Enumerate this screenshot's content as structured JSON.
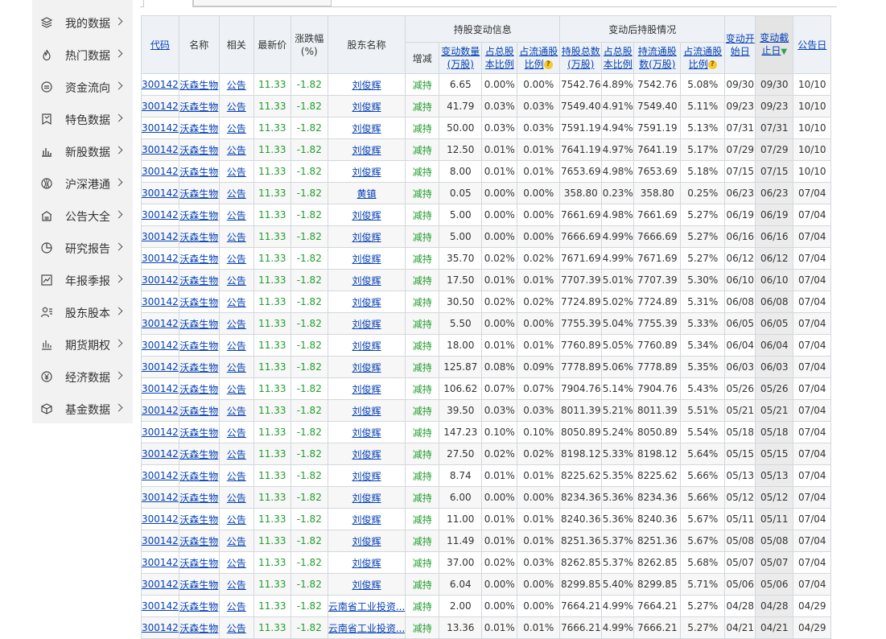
{
  "sidebar": {
    "items": [
      {
        "label": "我的数据",
        "icon": "layers-icon"
      },
      {
        "label": "热门数据",
        "icon": "fire-icon"
      },
      {
        "label": "资金流向",
        "icon": "money-flow-icon"
      },
      {
        "label": "特色数据",
        "icon": "bookmark-icon"
      },
      {
        "label": "新股数据",
        "icon": "bar-chart-icon"
      },
      {
        "label": "沪深港通",
        "icon": "globe-icon"
      },
      {
        "label": "公告大全",
        "icon": "announcement-icon"
      },
      {
        "label": "研究报告",
        "icon": "pie-chart-icon"
      },
      {
        "label": "年报季报",
        "icon": "line-chart-icon"
      },
      {
        "label": "股东股本",
        "icon": "shareholder-icon"
      },
      {
        "label": "期货期权",
        "icon": "futures-icon"
      },
      {
        "label": "经济数据",
        "icon": "yuan-icon"
      },
      {
        "label": "基金数据",
        "icon": "fund-icon"
      }
    ]
  },
  "table": {
    "headers": {
      "code": "代码",
      "name": "名称",
      "related": "相关",
      "price": "最新价",
      "change": "涨跌幅(%)",
      "holder": "股东名称",
      "group_change": "持股变动信息",
      "group_after": "变动后持股情况",
      "direction": "增减",
      "change_qty": "变动数量(万股)",
      "pct_total": "占总股本比例",
      "pct_float": "占流通股比例",
      "hold_total": "持股总数(万股)",
      "hold_total_pct": "占总股本比例",
      "float_hold": "持流通股数(万股)",
      "float_hold_pct": "占流通股比例",
      "start": "变动开始日",
      "end": "变动截止日",
      "notice": "公告日"
    },
    "rows": [
      [
        "300142",
        "沃森生物",
        "公告",
        "11.33",
        "-1.82",
        "刘俊辉",
        "减持",
        "6.65",
        "0.00%",
        "0.00%",
        "7542.76",
        "4.89%",
        "7542.76",
        "5.08%",
        "09/30",
        "09/30",
        "10/10"
      ],
      [
        "300142",
        "沃森生物",
        "公告",
        "11.33",
        "-1.82",
        "刘俊辉",
        "减持",
        "41.79",
        "0.03%",
        "0.03%",
        "7549.40",
        "4.91%",
        "7549.40",
        "5.11%",
        "09/23",
        "09/23",
        "10/10"
      ],
      [
        "300142",
        "沃森生物",
        "公告",
        "11.33",
        "-1.82",
        "刘俊辉",
        "减持",
        "50.00",
        "0.03%",
        "0.03%",
        "7591.19",
        "4.94%",
        "7591.19",
        "5.13%",
        "07/31",
        "07/31",
        "10/10"
      ],
      [
        "300142",
        "沃森生物",
        "公告",
        "11.33",
        "-1.82",
        "刘俊辉",
        "减持",
        "12.50",
        "0.01%",
        "0.01%",
        "7641.19",
        "4.97%",
        "7641.19",
        "5.17%",
        "07/29",
        "07/29",
        "10/10"
      ],
      [
        "300142",
        "沃森生物",
        "公告",
        "11.33",
        "-1.82",
        "刘俊辉",
        "减持",
        "8.00",
        "0.01%",
        "0.01%",
        "7653.69",
        "4.98%",
        "7653.69",
        "5.18%",
        "07/15",
        "07/15",
        "10/10"
      ],
      [
        "300142",
        "沃森生物",
        "公告",
        "11.33",
        "-1.82",
        "黄镇",
        "减持",
        "0.05",
        "0.00%",
        "0.00%",
        "358.80",
        "0.23%",
        "358.80",
        "0.25%",
        "06/23",
        "06/23",
        "07/04"
      ],
      [
        "300142",
        "沃森生物",
        "公告",
        "11.33",
        "-1.82",
        "刘俊辉",
        "减持",
        "5.00",
        "0.00%",
        "0.00%",
        "7661.69",
        "4.98%",
        "7661.69",
        "5.27%",
        "06/19",
        "06/19",
        "07/04"
      ],
      [
        "300142",
        "沃森生物",
        "公告",
        "11.33",
        "-1.82",
        "刘俊辉",
        "减持",
        "5.00",
        "0.00%",
        "0.00%",
        "7666.69",
        "4.99%",
        "7666.69",
        "5.27%",
        "06/16",
        "06/16",
        "07/04"
      ],
      [
        "300142",
        "沃森生物",
        "公告",
        "11.33",
        "-1.82",
        "刘俊辉",
        "减持",
        "35.70",
        "0.02%",
        "0.02%",
        "7671.69",
        "4.99%",
        "7671.69",
        "5.27%",
        "06/12",
        "06/12",
        "07/04"
      ],
      [
        "300142",
        "沃森生物",
        "公告",
        "11.33",
        "-1.82",
        "刘俊辉",
        "减持",
        "17.50",
        "0.01%",
        "0.01%",
        "7707.39",
        "5.01%",
        "7707.39",
        "5.30%",
        "06/10",
        "06/10",
        "07/04"
      ],
      [
        "300142",
        "沃森生物",
        "公告",
        "11.33",
        "-1.82",
        "刘俊辉",
        "减持",
        "30.50",
        "0.02%",
        "0.02%",
        "7724.89",
        "5.02%",
        "7724.89",
        "5.31%",
        "06/08",
        "06/08",
        "07/04"
      ],
      [
        "300142",
        "沃森生物",
        "公告",
        "11.33",
        "-1.82",
        "刘俊辉",
        "减持",
        "5.50",
        "0.00%",
        "0.00%",
        "7755.39",
        "5.04%",
        "7755.39",
        "5.33%",
        "06/05",
        "06/05",
        "07/04"
      ],
      [
        "300142",
        "沃森生物",
        "公告",
        "11.33",
        "-1.82",
        "刘俊辉",
        "减持",
        "18.00",
        "0.01%",
        "0.01%",
        "7760.89",
        "5.05%",
        "7760.89",
        "5.34%",
        "06/04",
        "06/04",
        "07/04"
      ],
      [
        "300142",
        "沃森生物",
        "公告",
        "11.33",
        "-1.82",
        "刘俊辉",
        "减持",
        "125.87",
        "0.08%",
        "0.09%",
        "7778.89",
        "5.06%",
        "7778.89",
        "5.35%",
        "06/03",
        "06/03",
        "07/04"
      ],
      [
        "300142",
        "沃森生物",
        "公告",
        "11.33",
        "-1.82",
        "刘俊辉",
        "减持",
        "106.62",
        "0.07%",
        "0.07%",
        "7904.76",
        "5.14%",
        "7904.76",
        "5.43%",
        "05/26",
        "05/26",
        "07/04"
      ],
      [
        "300142",
        "沃森生物",
        "公告",
        "11.33",
        "-1.82",
        "刘俊辉",
        "减持",
        "39.50",
        "0.03%",
        "0.03%",
        "8011.39",
        "5.21%",
        "8011.39",
        "5.51%",
        "05/21",
        "05/21",
        "07/04"
      ],
      [
        "300142",
        "沃森生物",
        "公告",
        "11.33",
        "-1.82",
        "刘俊辉",
        "减持",
        "147.23",
        "0.10%",
        "0.10%",
        "8050.89",
        "5.24%",
        "8050.89",
        "5.54%",
        "05/18",
        "05/18",
        "07/04"
      ],
      [
        "300142",
        "沃森生物",
        "公告",
        "11.33",
        "-1.82",
        "刘俊辉",
        "减持",
        "27.50",
        "0.02%",
        "0.02%",
        "8198.12",
        "5.33%",
        "8198.12",
        "5.64%",
        "05/15",
        "05/15",
        "07/04"
      ],
      [
        "300142",
        "沃森生物",
        "公告",
        "11.33",
        "-1.82",
        "刘俊辉",
        "减持",
        "8.74",
        "0.01%",
        "0.01%",
        "8225.62",
        "5.35%",
        "8225.62",
        "5.66%",
        "05/13",
        "05/13",
        "07/04"
      ],
      [
        "300142",
        "沃森生物",
        "公告",
        "11.33",
        "-1.82",
        "刘俊辉",
        "减持",
        "6.00",
        "0.00%",
        "0.00%",
        "8234.36",
        "5.36%",
        "8234.36",
        "5.66%",
        "05/12",
        "05/12",
        "07/04"
      ],
      [
        "300142",
        "沃森生物",
        "公告",
        "11.33",
        "-1.82",
        "刘俊辉",
        "减持",
        "11.00",
        "0.01%",
        "0.01%",
        "8240.36",
        "5.36%",
        "8240.36",
        "5.67%",
        "05/11",
        "05/11",
        "07/04"
      ],
      [
        "300142",
        "沃森生物",
        "公告",
        "11.33",
        "-1.82",
        "刘俊辉",
        "减持",
        "11.49",
        "0.01%",
        "0.01%",
        "8251.36",
        "5.37%",
        "8251.36",
        "5.67%",
        "05/08",
        "05/08",
        "07/04"
      ],
      [
        "300142",
        "沃森生物",
        "公告",
        "11.33",
        "-1.82",
        "刘俊辉",
        "减持",
        "37.00",
        "0.02%",
        "0.03%",
        "8262.85",
        "5.37%",
        "8262.85",
        "5.68%",
        "05/07",
        "05/07",
        "07/04"
      ],
      [
        "300142",
        "沃森生物",
        "公告",
        "11.33",
        "-1.82",
        "刘俊辉",
        "减持",
        "6.04",
        "0.00%",
        "0.00%",
        "8299.85",
        "5.40%",
        "8299.85",
        "5.71%",
        "05/06",
        "05/06",
        "07/04"
      ],
      [
        "300142",
        "沃森生物",
        "公告",
        "11.33",
        "-1.82",
        "云南省工业投资...",
        "减持",
        "2.00",
        "0.00%",
        "0.00%",
        "7664.21",
        "4.99%",
        "7664.21",
        "5.27%",
        "04/28",
        "04/28",
        "04/29"
      ],
      [
        "300142",
        "沃森生物",
        "公告",
        "11.33",
        "-1.82",
        "云南省工业投资...",
        "减持",
        "13.36",
        "0.01%",
        "0.01%",
        "7666.21",
        "4.99%",
        "7666.21",
        "5.27%",
        "04/21",
        "04/21",
        "04/29"
      ]
    ]
  }
}
